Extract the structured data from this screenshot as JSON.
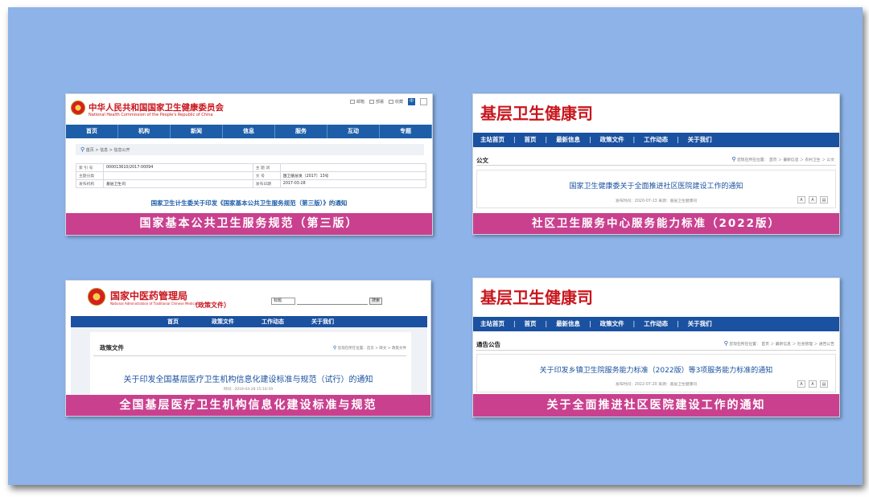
{
  "cards": {
    "nhc": {
      "org_name": "中华人民共和国国家卫生健康委员会",
      "org_name_en": "National Health Commission of the People's Republic of China",
      "tools": [
        "邮箱",
        "部署",
        "收藏"
      ],
      "tool_btn": "中",
      "nav": [
        "首页",
        "机构",
        "新闻",
        "信息",
        "服务",
        "互动",
        "专题"
      ],
      "breadcrumb": "首页 > 信息 > 信息公开",
      "table": {
        "r1": {
          "k1": "索 引 号",
          "v1": "000013610/2017-00094",
          "k2": "主 题 词",
          "v2": ""
        },
        "r2": {
          "k1": "主题分类",
          "v1": "",
          "k2": "文 号",
          "v2": "国卫基层发〔2017〕13号"
        },
        "r3": {
          "k1": "发布机构",
          "v1": "基层卫生司",
          "k2": "发布日期",
          "v2": "2017-03-28"
        }
      },
      "doc_title": "国家卫生计生委关于印发《国家基本公共卫生服务规范（第三版）》的通知",
      "caption": "国家基本公共卫生服务规范（第三版）"
    },
    "comm1": {
      "logo": "基层卫生健康司",
      "nav": [
        "主站首页",
        "首页",
        "最新信息",
        "政策文件",
        "工作动态",
        "关于我们"
      ],
      "section": "公文",
      "crumbs": "您现在所在位置： 首页 ＞ 最新信息 ＞ 农村卫生 ＞ 公文",
      "doc_title": "国家卫生健康委关于全面推进社区医院建设工作的通知",
      "meta": "发布时间：2020-07-13    来源：基层卫生健康司",
      "caption": "社区卫生服务中心服务能力标准（2022版）"
    },
    "tcm": {
      "org_name": "国家中医药管理局",
      "org_name_en": "National Administration of Traditional Chinese Medicine",
      "tag": "（政策文件）",
      "select_value": "标题",
      "search_btn": "搜索",
      "nav": [
        "首页",
        "政策文件",
        "工作动态",
        "关于我们"
      ],
      "section": "政策文件",
      "crumbs": "您现在所在位置：首页 > 政文 > 政策文件",
      "doc_title": "关于印发全国基层医疗卫生机构信息化建设标准与规范（试行）的通知",
      "meta": "时间：2019-04-28 15:16:59",
      "caption": "全国基层医疗卫生机构信息化建设标准与规范"
    },
    "comm2": {
      "logo": "基层卫生健康司",
      "nav": [
        "主站首页",
        "首页",
        "最新信息",
        "政策文件",
        "工作动态",
        "关于我们"
      ],
      "section": "通告公告",
      "crumbs": "您现在所在位置： 首页 ＞ 最新信息 ＞ 社会管理 ＞ 通告公告",
      "doc_title": "关于印发乡镇卫生院服务能力标准（2022版）等3项服务能力标准的通知",
      "meta": "发布时间：2022-07-20    来源：基层卫生健康司",
      "caption": "关于全面推进社区医院建设工作的通知"
    }
  },
  "colors": {
    "background": "#8db3e9",
    "caption_band": "#c9418e",
    "nav_blue": "#1e5ea8",
    "logo_red": "#c8161d"
  }
}
